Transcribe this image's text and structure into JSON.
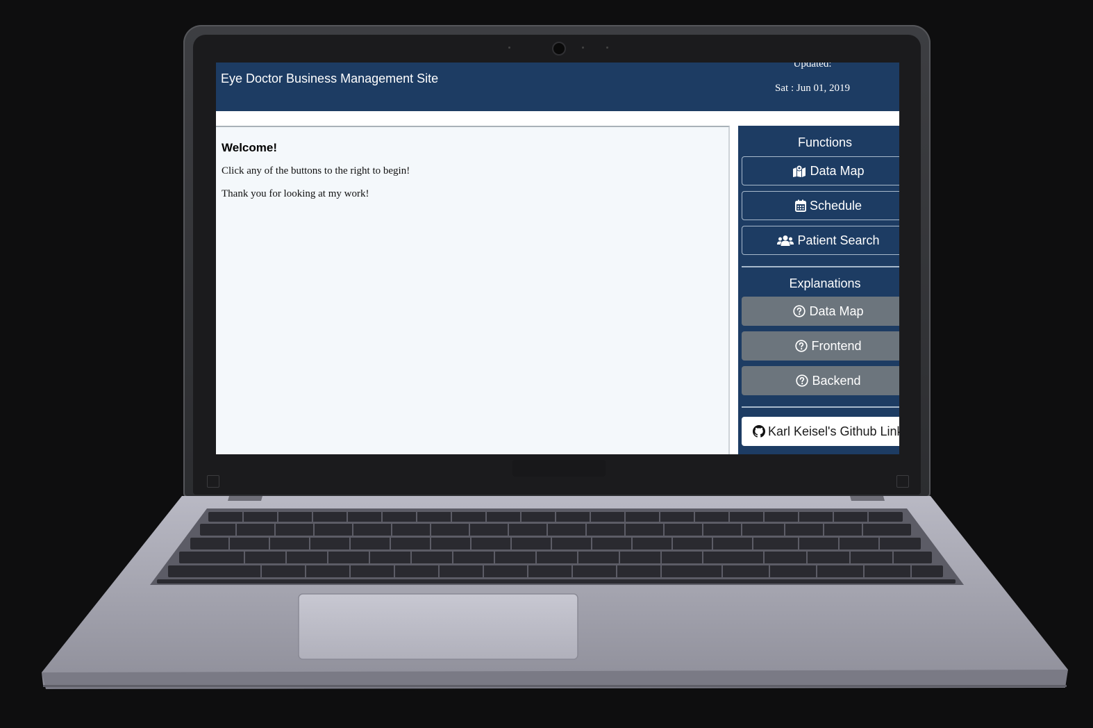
{
  "header": {
    "site_title": "Eye Doctor Business Management Site",
    "updated_label": "Updated:",
    "updated_date": "Sat : Jun 01, 2019"
  },
  "main": {
    "welcome": "Welcome!",
    "paragraphs": [
      "Click any of the buttons to the right to begin!",
      "Thank you for looking at my work!"
    ]
  },
  "sidebar": {
    "functions_heading": "Functions",
    "functions": [
      {
        "label": "Data Map",
        "icon": "map-marked-icon"
      },
      {
        "label": "Schedule",
        "icon": "calendar-icon"
      },
      {
        "label": "Patient Search",
        "icon": "users-icon"
      }
    ],
    "explanations_heading": "Explanations",
    "explanations": [
      {
        "label": "Data Map",
        "icon": "question-circle-icon"
      },
      {
        "label": "Frontend",
        "icon": "question-circle-icon"
      },
      {
        "label": "Backend",
        "icon": "question-circle-icon"
      }
    ],
    "github_label": "Karl Keisel's Github Link",
    "github_icon": "github-icon"
  },
  "colors": {
    "primary": "#1d3c63",
    "secondary_button": "#6c757d",
    "panel_background": "#f4f8fb"
  }
}
